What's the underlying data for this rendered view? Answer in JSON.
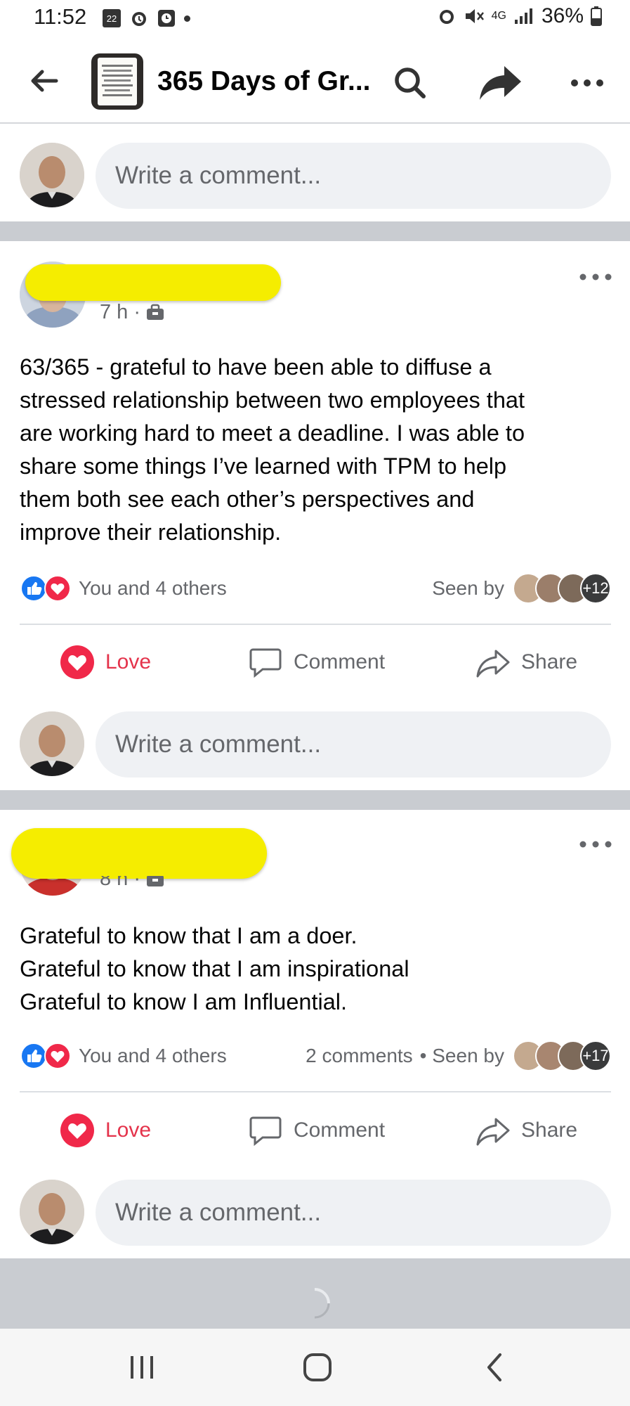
{
  "status_bar": {
    "time": "11:52",
    "calendar_day": "22",
    "battery": "36%",
    "network": "4G"
  },
  "header": {
    "title": "365 Days of Gr..."
  },
  "comment_placeholder": "Write a comment...",
  "posts": [
    {
      "time": "7 h ·",
      "text_lines": [
        "63/365 - grateful to have been able to diffuse a",
        "stressed relationship between two employees that",
        "are working hard to meet a deadline. I was able to",
        "share some things I’ve learned with TPM to help",
        "them both see each other’s perspectives and",
        "improve their relationship."
      ],
      "reactions": "You and 4 others",
      "comments": "",
      "seen_by": "Seen by",
      "seen_extra": "+12"
    },
    {
      "time": "8 h ·",
      "text_lines": [
        "Grateful to know that I am a doer.",
        "Grateful to know that I am inspirational",
        "Grateful to know I am Influential."
      ],
      "reactions": "You and 4 others",
      "comments": "2 comments",
      "seen_by": "• Seen by",
      "seen_extra": "+17"
    }
  ],
  "actions": {
    "love": "Love",
    "comment": "Comment",
    "share": "Share"
  },
  "colors": {
    "love_red": "#e4334b",
    "like_blue": "#1877f2",
    "redaction_yellow": "#f5ed00",
    "secondary_text": "#65676b"
  }
}
